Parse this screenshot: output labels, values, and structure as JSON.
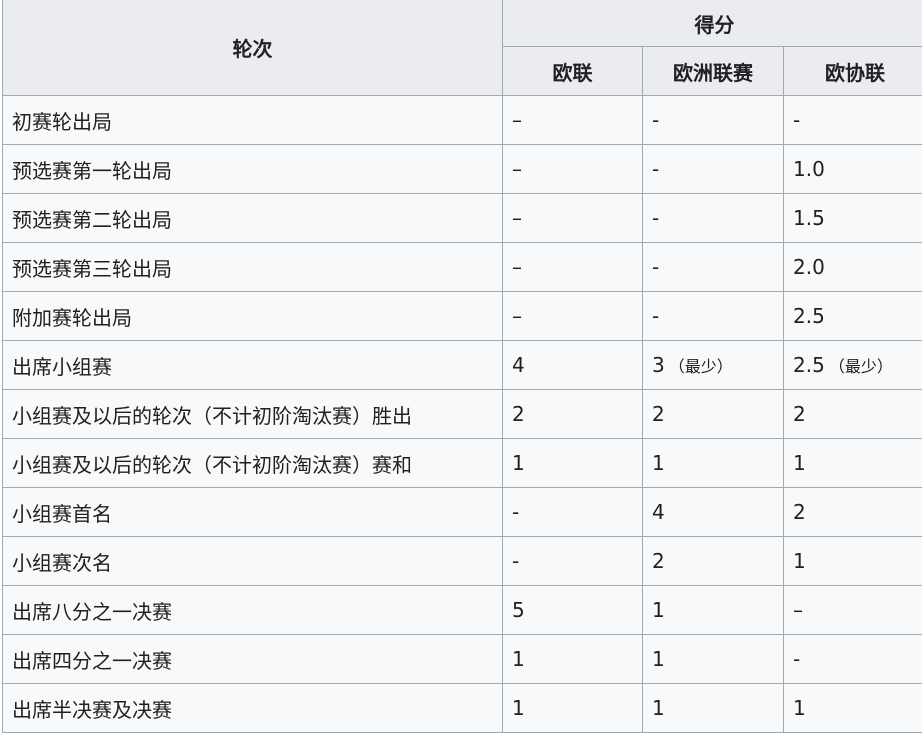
{
  "table": {
    "header": {
      "round_label": "轮次",
      "points_label": "得分",
      "columns": [
        "欧联",
        "欧洲联赛",
        "欧协联"
      ]
    },
    "rows": [
      {
        "round": "初赛轮出局",
        "ucl": "–",
        "uel": "-",
        "uecl": "-",
        "ucl_note": "",
        "uel_note": "",
        "uecl_note": ""
      },
      {
        "round": "预选赛第一轮出局",
        "ucl": "–",
        "uel": "-",
        "uecl": "1.0",
        "ucl_note": "",
        "uel_note": "",
        "uecl_note": ""
      },
      {
        "round": "预选赛第二轮出局",
        "ucl": "–",
        "uel": "-",
        "uecl": "1.5",
        "ucl_note": "",
        "uel_note": "",
        "uecl_note": ""
      },
      {
        "round": "预选赛第三轮出局",
        "ucl": "–",
        "uel": "-",
        "uecl": "2.0",
        "ucl_note": "",
        "uel_note": "",
        "uecl_note": ""
      },
      {
        "round": "附加赛轮出局",
        "ucl": "–",
        "uel": "-",
        "uecl": "2.5",
        "ucl_note": "",
        "uel_note": "",
        "uecl_note": ""
      },
      {
        "round": "出席小组赛",
        "ucl": "4",
        "uel": "3",
        "uecl": "2.5",
        "ucl_note": "",
        "uel_note": "（最少）",
        "uecl_note": "（最少）"
      },
      {
        "round": "小组赛及以后的轮次（不计初阶淘汰赛）胜出",
        "ucl": "2",
        "uel": "2",
        "uecl": "2",
        "ucl_note": "",
        "uel_note": "",
        "uecl_note": ""
      },
      {
        "round": "小组赛及以后的轮次（不计初阶淘汰赛）赛和",
        "ucl": "1",
        "uel": "1",
        "uecl": "1",
        "ucl_note": "",
        "uel_note": "",
        "uecl_note": ""
      },
      {
        "round": "小组赛首名",
        "ucl": "-",
        "uel": "4",
        "uecl": "2",
        "ucl_note": "",
        "uel_note": "",
        "uecl_note": ""
      },
      {
        "round": "小组赛次名",
        "ucl": "-",
        "uel": "2",
        "uecl": "1",
        "ucl_note": "",
        "uel_note": "",
        "uecl_note": ""
      },
      {
        "round": "出席八分之一决赛",
        "ucl": "5",
        "uel": "1",
        "uecl": "–",
        "ucl_note": "",
        "uel_note": "",
        "uecl_note": ""
      },
      {
        "round": "出席四分之一决赛",
        "ucl": "1",
        "uel": "1",
        "uecl": "-",
        "ucl_note": "",
        "uel_note": "",
        "uecl_note": ""
      },
      {
        "round": "出席半决赛及决赛",
        "ucl": "1",
        "uel": "1",
        "uecl": "1",
        "ucl_note": "",
        "uel_note": "",
        "uecl_note": ""
      }
    ]
  }
}
